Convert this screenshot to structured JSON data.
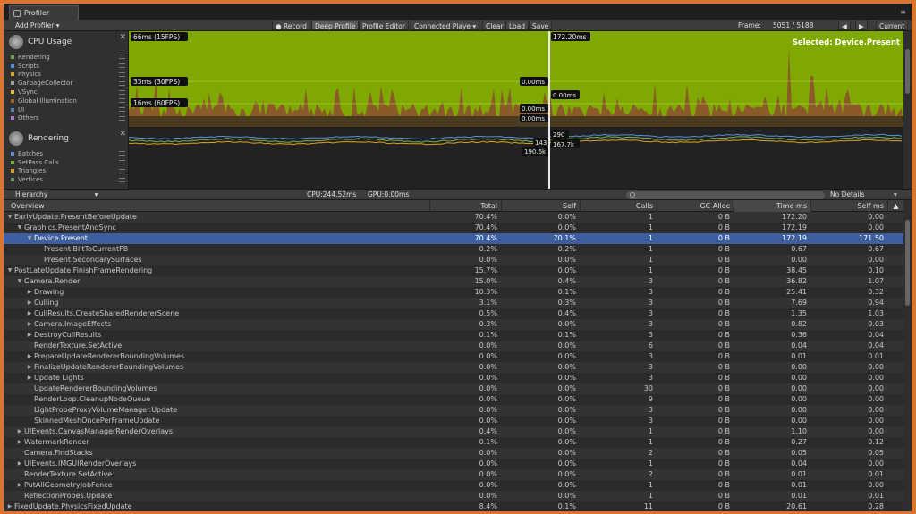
{
  "window": {
    "tab_title": "Profiler"
  },
  "toolbar": {
    "add_profiler": "Add Profiler",
    "record": "Record",
    "deep_profile": "Deep Profile",
    "profile_editor": "Profile Editor",
    "connected_player": "Connected Playe",
    "clear": "Clear",
    "load": "Load",
    "save": "Save",
    "frame_label": "Frame:",
    "frame_value": "5051 / 5188",
    "current": "Current"
  },
  "modules": {
    "cpu": {
      "title": "CPU Usage",
      "legend": [
        {
          "label": "Rendering",
          "color": "#6fa84a"
        },
        {
          "label": "Scripts",
          "color": "#4a8fd6"
        },
        {
          "label": "Physics",
          "color": "#e0a020"
        },
        {
          "label": "GarbageCollector",
          "color": "#9aa0a6"
        },
        {
          "label": "VSync",
          "color": "#e8c040"
        },
        {
          "label": "Global Illumination",
          "color": "#a06030"
        },
        {
          "label": "UI",
          "color": "#4f7fc0"
        },
        {
          "label": "Others",
          "color": "#b86fd0"
        }
      ]
    },
    "rendering": {
      "title": "Rendering",
      "legend": [
        {
          "label": "Batches",
          "color": "#5c8fd8"
        },
        {
          "label": "SetPass Calls",
          "color": "#7ab04a"
        },
        {
          "label": "Triangles",
          "color": "#e0a020"
        },
        {
          "label": "Vertices",
          "color": "#6a8a6a"
        }
      ]
    }
  },
  "graph": {
    "label_66": "66ms (15FPS)",
    "label_33": "33ms (30FPS)",
    "label_16": "16ms (60FPS)",
    "cursor_time": "172.20ms",
    "selected": "Selected: Device.Present",
    "val_a": "0.00ms",
    "val_b": "0.00ms",
    "val_c": "0.00ms",
    "val_d": "0.00ms",
    "r_290": "290",
    "r_143": "143",
    "r_167": "167.7k",
    "r_190": "190.6k"
  },
  "hierarchy_bar": {
    "mode": "Hierarchy",
    "cpu": "CPU:244.52ms",
    "gpu": "GPU:0.00ms",
    "details": "No Details"
  },
  "columns": {
    "overview": "Overview",
    "total": "Total",
    "self": "Self",
    "calls": "Calls",
    "gc": "GC Alloc",
    "time": "Time ms",
    "selfms": "Self ms"
  },
  "rows": [
    {
      "name": "EarlyUpdate.PresentBeforeUpdate",
      "indent": 0,
      "arrow": "open",
      "total": "70.4%",
      "self": "0.0%",
      "calls": "1",
      "gc": "0 B",
      "time": "172.20",
      "selfms": "0.00"
    },
    {
      "name": "Graphics.PresentAndSync",
      "indent": 1,
      "arrow": "open",
      "total": "70.4%",
      "self": "0.0%",
      "calls": "1",
      "gc": "0 B",
      "time": "172.19",
      "selfms": "0.00"
    },
    {
      "name": "Device.Present",
      "indent": 2,
      "arrow": "open",
      "total": "70.4%",
      "self": "70.1%",
      "calls": "1",
      "gc": "0 B",
      "time": "172.19",
      "selfms": "171.50",
      "selected": true
    },
    {
      "name": "Present.BlitToCurrentFB",
      "indent": 3,
      "arrow": "none",
      "total": "0.2%",
      "self": "0.2%",
      "calls": "1",
      "gc": "0 B",
      "time": "0.67",
      "selfms": "0.67"
    },
    {
      "name": "Present.SecondarySurfaces",
      "indent": 3,
      "arrow": "none",
      "total": "0.0%",
      "self": "0.0%",
      "calls": "1",
      "gc": "0 B",
      "time": "0.00",
      "selfms": "0.00"
    },
    {
      "name": "PostLateUpdate.FinishFrameRendering",
      "indent": 0,
      "arrow": "open",
      "total": "15.7%",
      "self": "0.0%",
      "calls": "1",
      "gc": "0 B",
      "time": "38.45",
      "selfms": "0.10"
    },
    {
      "name": "Camera.Render",
      "indent": 1,
      "arrow": "open",
      "total": "15.0%",
      "self": "0.4%",
      "calls": "3",
      "gc": "0 B",
      "time": "36.82",
      "selfms": "1.07"
    },
    {
      "name": "Drawing",
      "indent": 2,
      "arrow": "closed",
      "total": "10.3%",
      "self": "0.1%",
      "calls": "3",
      "gc": "0 B",
      "time": "25.41",
      "selfms": "0.32"
    },
    {
      "name": "Culling",
      "indent": 2,
      "arrow": "closed",
      "total": "3.1%",
      "self": "0.3%",
      "calls": "3",
      "gc": "0 B",
      "time": "7.69",
      "selfms": "0.94"
    },
    {
      "name": "CullResults.CreateSharedRendererScene",
      "indent": 2,
      "arrow": "closed",
      "total": "0.5%",
      "self": "0.4%",
      "calls": "3",
      "gc": "0 B",
      "time": "1.35",
      "selfms": "1.03"
    },
    {
      "name": "Camera.ImageEffects",
      "indent": 2,
      "arrow": "closed",
      "total": "0.3%",
      "self": "0.0%",
      "calls": "3",
      "gc": "0 B",
      "time": "0.82",
      "selfms": "0.03"
    },
    {
      "name": "DestroyCullResults",
      "indent": 2,
      "arrow": "closed",
      "total": "0.1%",
      "self": "0.1%",
      "calls": "3",
      "gc": "0 B",
      "time": "0.36",
      "selfms": "0.04"
    },
    {
      "name": "RenderTexture.SetActive",
      "indent": 2,
      "arrow": "none",
      "total": "0.0%",
      "self": "0.0%",
      "calls": "6",
      "gc": "0 B",
      "time": "0.04",
      "selfms": "0.04"
    },
    {
      "name": "PrepareUpdateRendererBoundingVolumes",
      "indent": 2,
      "arrow": "closed",
      "total": "0.0%",
      "self": "0.0%",
      "calls": "3",
      "gc": "0 B",
      "time": "0.01",
      "selfms": "0.01"
    },
    {
      "name": "FinalizeUpdateRendererBoundingVolumes",
      "indent": 2,
      "arrow": "closed",
      "total": "0.0%",
      "self": "0.0%",
      "calls": "3",
      "gc": "0 B",
      "time": "0.00",
      "selfms": "0.00"
    },
    {
      "name": "Update Lights",
      "indent": 2,
      "arrow": "closed",
      "total": "0.0%",
      "self": "0.0%",
      "calls": "3",
      "gc": "0 B",
      "time": "0.00",
      "selfms": "0.00"
    },
    {
      "name": "UpdateRendererBoundingVolumes",
      "indent": 2,
      "arrow": "none",
      "total": "0.0%",
      "self": "0.0%",
      "calls": "30",
      "gc": "0 B",
      "time": "0.00",
      "selfms": "0.00"
    },
    {
      "name": "RenderLoop.CleanupNodeQueue",
      "indent": 2,
      "arrow": "none",
      "total": "0.0%",
      "self": "0.0%",
      "calls": "9",
      "gc": "0 B",
      "time": "0.00",
      "selfms": "0.00"
    },
    {
      "name": "LightProbeProxyVolumeManager.Update",
      "indent": 2,
      "arrow": "none",
      "total": "0.0%",
      "self": "0.0%",
      "calls": "3",
      "gc": "0 B",
      "time": "0.00",
      "selfms": "0.00"
    },
    {
      "name": "SkinnedMeshOncePerFrameUpdate",
      "indent": 2,
      "arrow": "none",
      "total": "0.0%",
      "self": "0.0%",
      "calls": "3",
      "gc": "0 B",
      "time": "0.00",
      "selfms": "0.00"
    },
    {
      "name": "UIEvents.CanvasManagerRenderOverlays",
      "indent": 1,
      "arrow": "closed",
      "total": "0.4%",
      "self": "0.0%",
      "calls": "1",
      "gc": "0 B",
      "time": "1.10",
      "selfms": "0.00"
    },
    {
      "name": "WatermarkRender",
      "indent": 1,
      "arrow": "closed",
      "total": "0.1%",
      "self": "0.0%",
      "calls": "1",
      "gc": "0 B",
      "time": "0.27",
      "selfms": "0.12"
    },
    {
      "name": "Camera.FindStacks",
      "indent": 1,
      "arrow": "none",
      "total": "0.0%",
      "self": "0.0%",
      "calls": "2",
      "gc": "0 B",
      "time": "0.05",
      "selfms": "0.05"
    },
    {
      "name": "UIEvents.IMGUIRenderOverlays",
      "indent": 1,
      "arrow": "closed",
      "total": "0.0%",
      "self": "0.0%",
      "calls": "1",
      "gc": "0 B",
      "time": "0.04",
      "selfms": "0.00"
    },
    {
      "name": "RenderTexture.SetActive",
      "indent": 1,
      "arrow": "none",
      "total": "0.0%",
      "self": "0.0%",
      "calls": "2",
      "gc": "0 B",
      "time": "0.01",
      "selfms": "0.01"
    },
    {
      "name": "PutAllGeometryJobFence",
      "indent": 1,
      "arrow": "closed",
      "total": "0.0%",
      "self": "0.0%",
      "calls": "1",
      "gc": "0 B",
      "time": "0.01",
      "selfms": "0.00"
    },
    {
      "name": "ReflectionProbes.Update",
      "indent": 1,
      "arrow": "none",
      "total": "0.0%",
      "self": "0.0%",
      "calls": "1",
      "gc": "0 B",
      "time": "0.01",
      "selfms": "0.01"
    },
    {
      "name": "FixedUpdate.PhysicsFixedUpdate",
      "indent": 0,
      "arrow": "closed",
      "total": "8.4%",
      "self": "0.1%",
      "calls": "11",
      "gc": "0 B",
      "time": "20.61",
      "selfms": "0.28"
    }
  ]
}
